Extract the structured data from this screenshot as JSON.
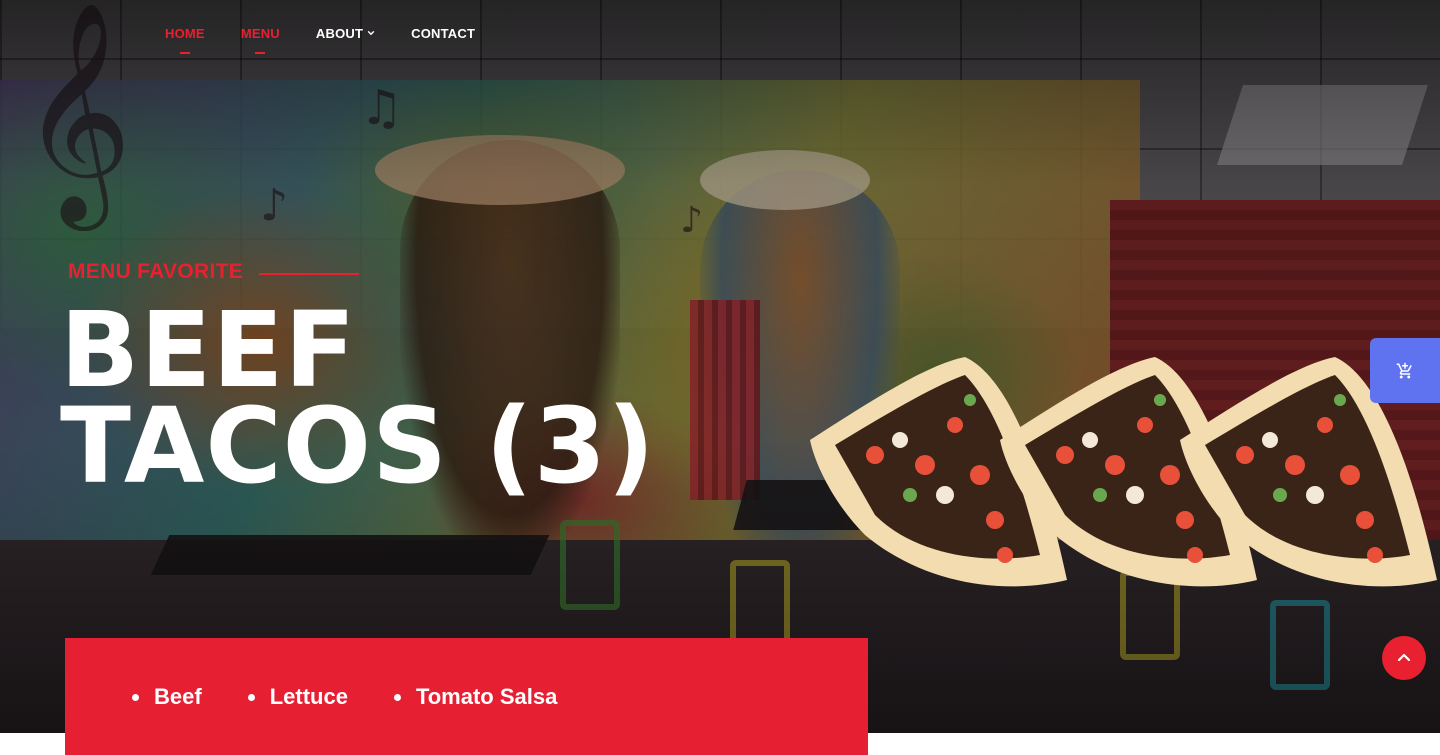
{
  "nav": {
    "items": [
      {
        "label": "HOME",
        "active": true
      },
      {
        "label": "MENU",
        "active": true
      },
      {
        "label": "ABOUT",
        "active": false,
        "has_dropdown": true
      },
      {
        "label": "CONTACT",
        "active": false
      }
    ]
  },
  "hero": {
    "eyebrow": "MENU FAVORITE",
    "title_line1": "BEEF",
    "title_line2": "TACOS (3)"
  },
  "ingredients": [
    "Beef",
    "Lettuce",
    "Tomato Salsa"
  ],
  "icons": {
    "cart": "add-to-cart-icon",
    "scroll_top": "chevron-up-icon",
    "dropdown": "chevron-down-icon"
  },
  "colors": {
    "accent": "#e8202f",
    "ingredients_bg": "#e71f33",
    "cart_button": "#5f73f0",
    "text": "#ffffff"
  }
}
